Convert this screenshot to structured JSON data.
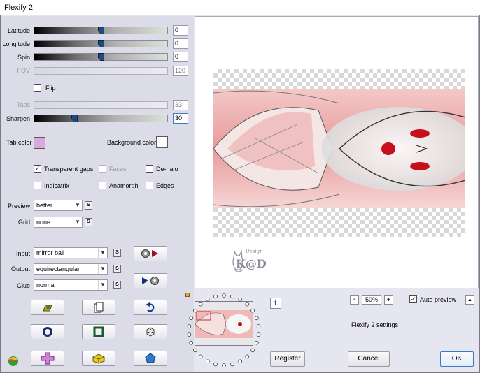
{
  "window": {
    "title": "Flexify 2"
  },
  "sliders": {
    "latitude": {
      "label": "Latitude",
      "value": "0",
      "fraction": 0.5
    },
    "longitude": {
      "label": "Longitude",
      "value": "0",
      "fraction": 0.5
    },
    "spin": {
      "label": "Spin",
      "value": "0",
      "fraction": 0.5
    },
    "fov": {
      "label": "FOV",
      "value": "120",
      "fraction": null
    },
    "tabs": {
      "label": "Tabs",
      "value": "33",
      "fraction": null
    },
    "sharpen": {
      "label": "Sharpen",
      "value": "30",
      "fraction": 0.3
    }
  },
  "checkboxes": {
    "flip": {
      "label": "Flip",
      "checked": false
    },
    "transparent_gaps": {
      "label": "Transparent gaps",
      "checked": true
    },
    "faces": {
      "label": "Faces",
      "checked": false
    },
    "de_halo": {
      "label": "De-halo",
      "checked": false
    },
    "indicatrix": {
      "label": "Indicatrix",
      "checked": false
    },
    "anamorph": {
      "label": "Anamorph",
      "checked": false
    },
    "edges": {
      "label": "Edges",
      "checked": false
    }
  },
  "colors": {
    "tab_color_label": "Tab color",
    "tab_color": "#d9a8dc",
    "background_color_label": "Background color",
    "background_color": "#ffffff"
  },
  "dropdowns": {
    "preview": {
      "label": "Preview",
      "value": "better"
    },
    "grid": {
      "label": "Grid",
      "value": "none"
    },
    "input": {
      "label": "Input",
      "value": "mirror ball"
    },
    "output": {
      "label": "Output",
      "value": "equirectangular"
    },
    "glue": {
      "label": "Glue",
      "value": "normal"
    }
  },
  "small_button_label": "S",
  "zoom": {
    "minus": "-",
    "value": "50%",
    "plus": "+"
  },
  "auto_preview": {
    "label": "Auto preview",
    "checked": true
  },
  "collapse_label": "▲",
  "info_label": "i",
  "settings_label": "Flexify 2 settings",
  "buttons": {
    "register": "Register",
    "cancel": "Cancel",
    "ok": "OK"
  },
  "watermark": {
    "small": "Design",
    "main": "K@D"
  }
}
